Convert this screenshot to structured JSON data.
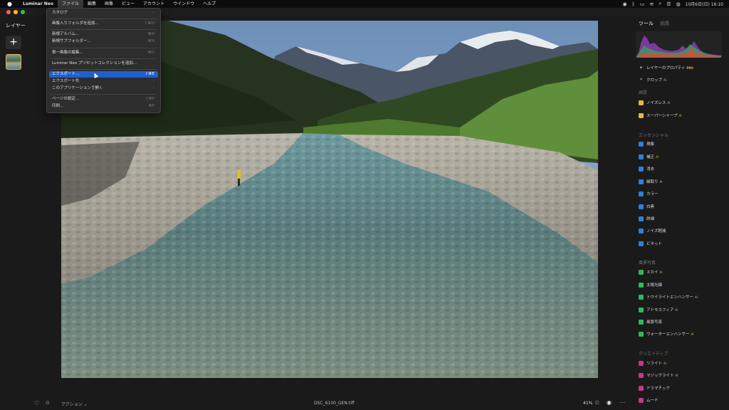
{
  "menubar": {
    "apple": "",
    "app_name": "Luminar Neo",
    "items": [
      "ファイル",
      "編集",
      "画像",
      "ビュー",
      "アカウント",
      "ウインドウ",
      "ヘルプ"
    ],
    "clock": "10月6日(日) 16:10"
  },
  "file_menu": {
    "items": [
      {
        "label": "カタログ",
        "shortcut": "›"
      },
      {
        "label": "画像入りフォルダを追加...",
        "shortcut": "⇧⌘O"
      },
      {
        "label": "新規アルバム...",
        "shortcut": "⌘N"
      },
      {
        "label": "新規サブフォルダー...",
        "shortcut": "⌘N"
      },
      {
        "label": "単一画像の編集...",
        "shortcut": "⌘O"
      },
      {
        "label": "Luminar Neo プリセットコレクションを追加...",
        "shortcut": ""
      },
      {
        "label": "エクスポート...",
        "shortcut": "⇧⌘E"
      },
      {
        "label": "エクスポート先",
        "shortcut": "›"
      },
      {
        "label": "このアプリケーションで開く",
        "shortcut": "›"
      },
      {
        "label": "ページの設定...",
        "shortcut": "⇧⌘P"
      },
      {
        "label": "印刷...",
        "shortcut": "⌘P"
      }
    ]
  },
  "left_panel": {
    "title": "レイヤー",
    "add_label": "+"
  },
  "right_panel": {
    "tabs": [
      "ツール",
      "編集"
    ],
    "tools_top": [
      {
        "label": "レイヤーのプロパティ",
        "badge": "PRO",
        "icon": "layers-icon"
      },
      {
        "label": "クロップ",
        "badge": "AI",
        "icon": "crop-icon"
      }
    ],
    "sections": [
      {
        "title": "画質",
        "items": [
          {
            "label": "ノイズレス",
            "badge": "AI",
            "color": "#e7b548"
          },
          {
            "label": "スーパーシャープ",
            "badge": "AI",
            "color": "#e7b548"
          }
        ]
      },
      {
        "title": "エッセンシャル",
        "items": [
          {
            "label": "現像",
            "badge": "",
            "color": "#2f7fd8"
          },
          {
            "label": "補正",
            "badge": "AI",
            "color": "#2f7fd8"
          },
          {
            "label": "消去",
            "badge": "",
            "color": "#2f7fd8"
          },
          {
            "label": "縁取り",
            "badge": "AI",
            "color": "#2f7fd8"
          },
          {
            "label": "カラー",
            "badge": "",
            "color": "#2f7fd8"
          },
          {
            "label": "白黒",
            "badge": "",
            "color": "#2f7fd8"
          },
          {
            "label": "詳細",
            "badge": "",
            "color": "#2f7fd8"
          },
          {
            "label": "ノイズ軽減",
            "badge": "",
            "color": "#2f7fd8"
          },
          {
            "label": "ビネット",
            "badge": "",
            "color": "#2f7fd8"
          }
        ]
      },
      {
        "title": "風景写真",
        "items": [
          {
            "label": "スカイ",
            "badge": "AI",
            "color": "#2fb85a"
          },
          {
            "label": "太陽光線",
            "badge": "",
            "color": "#2fb85a"
          },
          {
            "label": "トワイライトエンハンサー",
            "badge": "AI",
            "color": "#2fb85a"
          },
          {
            "label": "アトモスフィア",
            "badge": "AI",
            "color": "#2fb85a"
          },
          {
            "label": "風景写真",
            "badge": "",
            "color": "#2fb85a"
          },
          {
            "label": "ウォーターエンハンサー",
            "badge": "AI",
            "color": "#2fb85a"
          }
        ]
      },
      {
        "title": "クリエイティブ",
        "items": [
          {
            "label": "リライト",
            "badge": "AI",
            "color": "#c8358a"
          },
          {
            "label": "マジックライト",
            "badge": "AI",
            "color": "#c8358a"
          },
          {
            "label": "ドラマチック",
            "badge": "",
            "color": "#c8358a"
          },
          {
            "label": "ムード",
            "badge": "",
            "color": "#c8358a"
          }
        ]
      }
    ]
  },
  "bottom_bar": {
    "actions_label": "アクション",
    "filename": "DSC_6100_GEN.tiff",
    "zoom": "41%"
  }
}
